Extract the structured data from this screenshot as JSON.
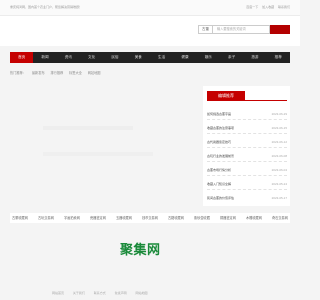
{
  "topbar": {
    "left_text": "重庆纯鸿网，国内首个农业门户，帮您解决营销难题！",
    "right_links": [
      "百度一下",
      "加入收藏",
      "联系我们"
    ]
  },
  "search": {
    "label": "古董",
    "placeholder": "输入要搜索的关键词"
  },
  "nav": {
    "items": [
      "首页",
      "新闻",
      "资讯",
      "文化",
      "民俗",
      "美食",
      "生活",
      "健康",
      "娱乐",
      "亲子",
      "旅游",
      "推荐"
    ]
  },
  "subnav": [
    "热门推荐：",
    "最新发布",
    "排行推荐",
    "标签大全",
    "网站地图"
  ],
  "sidebar": {
    "title": "编辑推荐",
    "items": [
      {
        "title": "如何挑选古董字画",
        "date": "2023-06-29"
      },
      {
        "title": "收藏古董的注意事项",
        "date": "2023-06-15"
      },
      {
        "title": "古代瓷器鉴定技巧",
        "date": "2023-06-12"
      },
      {
        "title": "古玩行业的发展前景",
        "date": "2023-06-08"
      },
      {
        "title": "古董市场行情分析",
        "date": "2023-06-04"
      },
      {
        "title": "收藏入门知识全解",
        "date": "2023-05-24"
      },
      {
        "title": "民间古董的价值评估",
        "date": "2023-05-17"
      }
    ]
  },
  "links": [
    "古董收藏网",
    "古玩交易网",
    "字画拍卖网",
    "瓷器鉴定网",
    "玉器收藏网",
    "钱币交易网",
    "古籍收藏网",
    "紫砂壶收藏",
    "铜器鉴定网",
    "木雕收藏网",
    "奇石交易网"
  ],
  "logo": "聚集网",
  "footer": [
    "网站首页",
    "关于我们",
    "联系方式",
    "免责声明",
    "网站地图"
  ]
}
